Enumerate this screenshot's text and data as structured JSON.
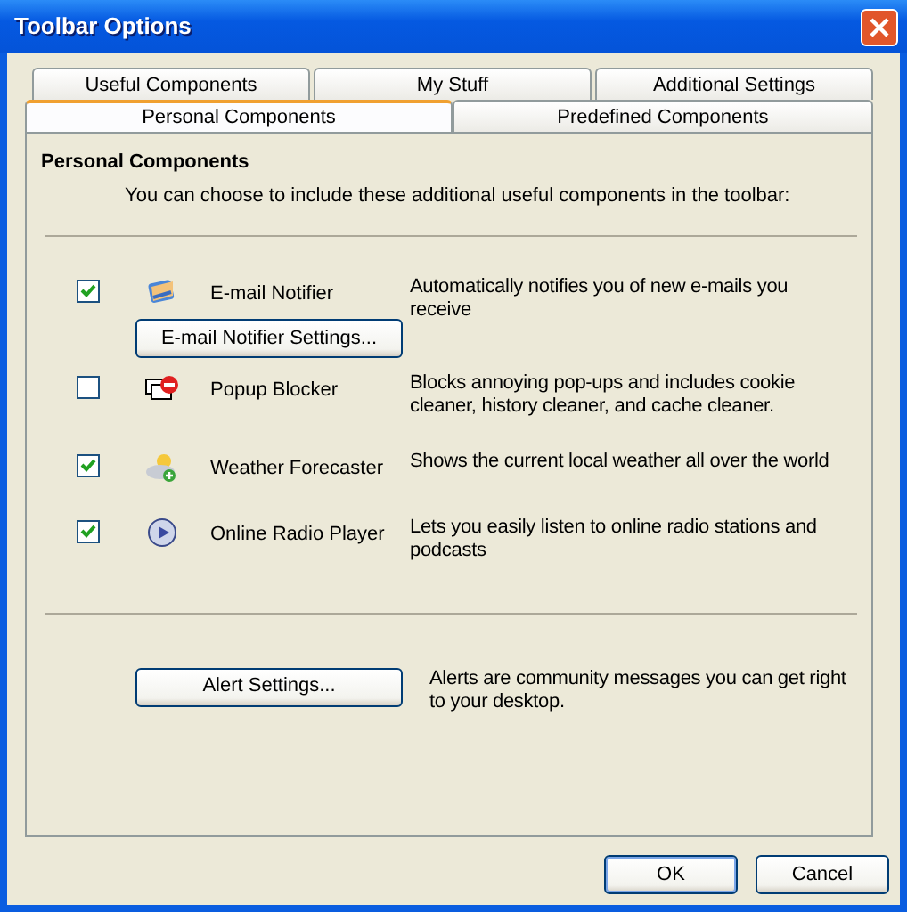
{
  "window": {
    "title": "Toolbar Options"
  },
  "tab_rows": [
    [
      {
        "label": "Useful Components",
        "selected": false
      },
      {
        "label": "My Stuff",
        "selected": false
      },
      {
        "label": "Additional Settings",
        "selected": false
      }
    ],
    [
      {
        "label": "Personal Components",
        "selected": true
      },
      {
        "label": "Predefined Components",
        "selected": false
      }
    ]
  ],
  "panel": {
    "heading": "Personal Components",
    "intro": "You can choose to include these additional useful components in the toolbar:"
  },
  "components": [
    {
      "name": "E-mail Notifier",
      "kind": "envelope",
      "checked": true,
      "description": "Automatically notifies you of new e-mails you receive",
      "button": "E-mail Notifier Settings..."
    },
    {
      "name": "Popup Blocker",
      "kind": "blocker",
      "checked": false,
      "description": "Blocks annoying pop-ups and includes cookie cleaner, history cleaner, and cache cleaner."
    },
    {
      "name": "Weather Forecaster",
      "kind": "weather",
      "checked": true,
      "description": "Shows the current local weather all over the world"
    },
    {
      "name": "Online Radio Player",
      "kind": "play",
      "checked": true,
      "description": "Lets you easily listen to online radio stations and podcasts"
    }
  ],
  "alerts": {
    "button": "Alert Settings...",
    "description": "Alerts are community messages you can get right to your desktop."
  },
  "buttons": [
    {
      "label": "OK",
      "default": true
    },
    {
      "label": "Cancel",
      "default": false
    }
  ]
}
